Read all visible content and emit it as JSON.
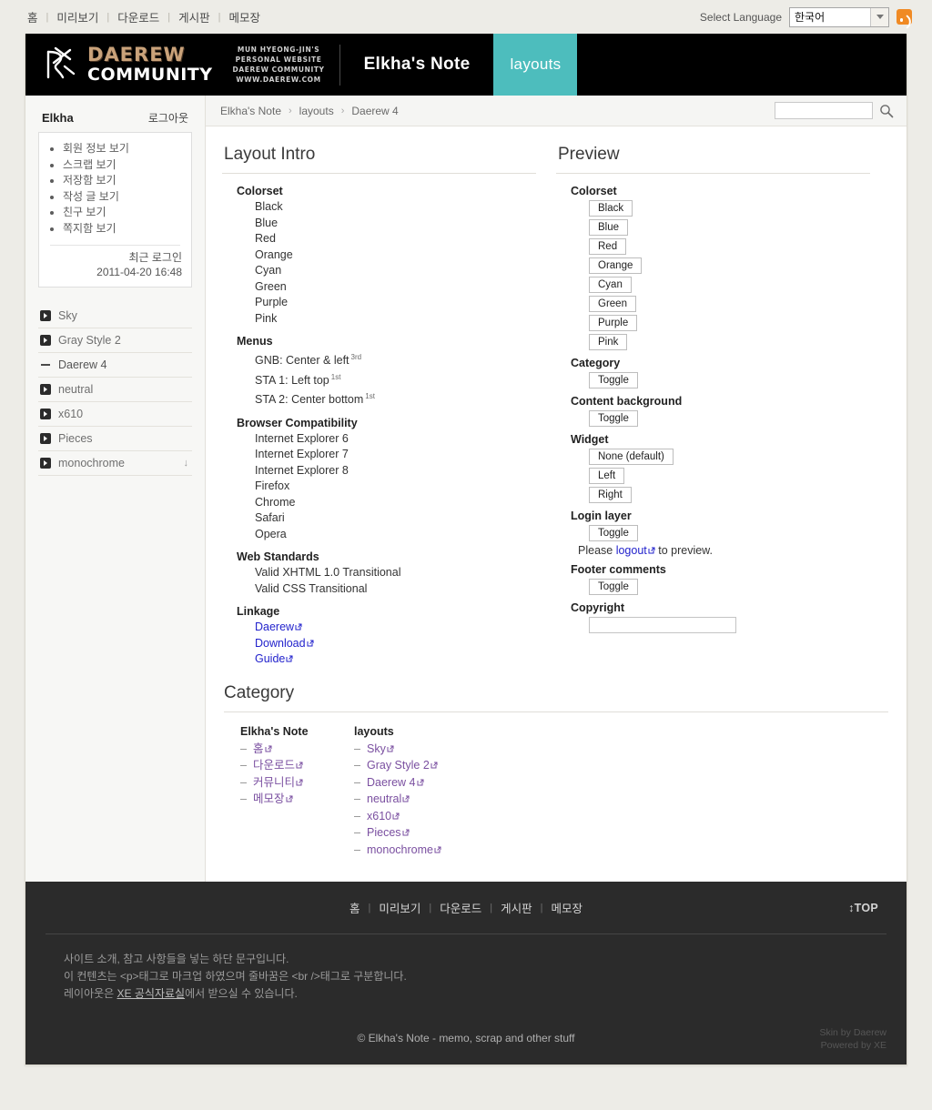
{
  "topbar": {
    "nav": [
      "홈",
      "미리보기",
      "다운로드",
      "게시판",
      "메모장"
    ],
    "lang_label": "Select Language",
    "lang_value": "한국어",
    "rss_icon": "rss-icon"
  },
  "header": {
    "logo_line1": "DAEREW",
    "logo_line2": "COMMUNITY",
    "tagline_lines": [
      "MUN HYEONG-JIN'S",
      "PERSONAL WEBSITE",
      "DAEREW COMMUNITY",
      "WWW.DAEREW.COM"
    ],
    "site_title": "Elkha's Note",
    "active_tab": "layouts",
    "accent_color": "#4dbdbd"
  },
  "sidebar": {
    "user_name": "Elkha",
    "logout_label": "로그아웃",
    "user_menu": [
      "회원 정보 보기",
      "스크랩 보기",
      "저장함 보기",
      "작성 글 보기",
      "친구 보기",
      "쪽지함 보기"
    ],
    "login_label": "최근 로그인",
    "login_date": "2011-04-20 16:48",
    "layouts": [
      {
        "label": "Sky",
        "icon": "arrow-right-icon",
        "active": false,
        "download": false
      },
      {
        "label": "Gray Style 2",
        "icon": "arrow-right-icon",
        "active": false,
        "download": false
      },
      {
        "label": "Daerew 4",
        "icon": "dash-icon",
        "active": true,
        "download": false
      },
      {
        "label": "neutral",
        "icon": "arrow-right-icon",
        "active": false,
        "download": false
      },
      {
        "label": "x610",
        "icon": "arrow-right-icon",
        "active": false,
        "download": false
      },
      {
        "label": "Pieces",
        "icon": "arrow-right-icon",
        "active": false,
        "download": false
      },
      {
        "label": "monochrome",
        "icon": "arrow-right-icon",
        "active": false,
        "download": true
      }
    ]
  },
  "breadcrumb": {
    "items": [
      "Elkha's Note",
      "layouts",
      "Daerew 4"
    ],
    "separator": "›",
    "search_value": "",
    "search_placeholder": ""
  },
  "intro": {
    "title": "Layout Intro",
    "groups": [
      {
        "heading": "Colorset",
        "items": [
          {
            "text": "Black"
          },
          {
            "text": "Blue"
          },
          {
            "text": "Red"
          },
          {
            "text": "Orange"
          },
          {
            "text": "Cyan"
          },
          {
            "text": "Green"
          },
          {
            "text": "Purple"
          },
          {
            "text": "Pink"
          }
        ]
      },
      {
        "heading": "Menus",
        "items": [
          {
            "text": "GNB: Center & left",
            "sup": "3rd"
          },
          {
            "text": "STA 1: Left top",
            "sup": "1st"
          },
          {
            "text": "STA 2: Center bottom",
            "sup": "1st"
          }
        ]
      },
      {
        "heading": "Browser Compatibility",
        "items": [
          {
            "text": "Internet Explorer 6"
          },
          {
            "text": "Internet Explorer 7"
          },
          {
            "text": "Internet Explorer 8"
          },
          {
            "text": "Firefox"
          },
          {
            "text": "Chrome"
          },
          {
            "text": "Safari"
          },
          {
            "text": "Opera"
          }
        ]
      },
      {
        "heading": "Web Standards",
        "items": [
          {
            "text": "Valid XHTML 1.0 Transitional"
          },
          {
            "text": "Valid CSS Transitional"
          }
        ]
      },
      {
        "heading": "Linkage",
        "items": [
          {
            "text": "Daerew",
            "link": true
          },
          {
            "text": "Download",
            "link": true
          },
          {
            "text": "Guide",
            "link": true
          }
        ]
      }
    ]
  },
  "preview": {
    "title": "Preview",
    "groups": [
      {
        "heading": "Colorset",
        "buttons": [
          "Black",
          "Blue",
          "Red",
          "Orange",
          "Cyan",
          "Green",
          "Purple",
          "Pink"
        ]
      },
      {
        "heading": "Category",
        "buttons": [
          "Toggle"
        ]
      },
      {
        "heading": "Content background",
        "buttons": [
          "Toggle"
        ]
      },
      {
        "heading": "Widget",
        "buttons": [
          "None (default)",
          "Left",
          "Right"
        ]
      },
      {
        "heading": "Login layer",
        "buttons": [
          "Toggle"
        ],
        "note_before": "Please ",
        "note_link": "logout",
        "note_after": " to preview."
      },
      {
        "heading": "Footer comments",
        "buttons": [
          "Toggle"
        ]
      },
      {
        "heading": "Copyright",
        "input": true,
        "input_value": ""
      }
    ]
  },
  "category": {
    "title": "Category",
    "columns": [
      {
        "heading": "Elkha's Note",
        "items": [
          "홈",
          "다운로드",
          "커뮤니티",
          "메모장"
        ]
      },
      {
        "heading": "layouts",
        "items": [
          "Sky",
          "Gray Style 2",
          "Daerew 4",
          "neutral",
          "x610",
          "Pieces",
          "monochrome"
        ]
      }
    ]
  },
  "footer": {
    "nav": [
      "홈",
      "미리보기",
      "다운로드",
      "게시판",
      "메모장"
    ],
    "top_label": "↕TOP",
    "text_lines": [
      "사이트 소개, 참고 사항들을 넣는 하단 문구입니다.",
      "이 컨텐츠는 <p>태그로 마크업 하였으며 줄바꿈은 <br />태그로 구분합니다."
    ],
    "text_line3_before": "레이아웃은 ",
    "text_line3_link": "XE 공식자료실",
    "text_line3_after": "에서 받으실 수 있습니다.",
    "copyright": "© Elkha's Note - memo, scrap and other stuff",
    "credit_lines": [
      "Skin by Daerew",
      "Powered by XE"
    ]
  }
}
